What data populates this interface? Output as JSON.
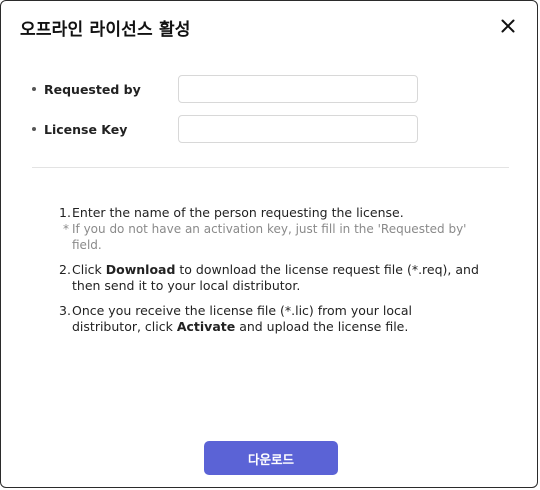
{
  "dialog": {
    "title": "오프라인 라이선스 활성",
    "close_icon": "close-icon"
  },
  "form": {
    "requested_by": {
      "label": "Requested by",
      "value": "",
      "placeholder": ""
    },
    "license_key": {
      "label": "License Key",
      "value": "",
      "placeholder": ""
    }
  },
  "instructions": {
    "step1": {
      "num": "1.",
      "text": "Enter the name of the person requesting the license.",
      "note_star": "*",
      "note": "If you do not have an activation key, just fill in the 'Requested by' field."
    },
    "step2": {
      "num": "2.",
      "pre": "Click ",
      "bold": "Download",
      "post": " to download the license request file (*.req), and then send it to your local distributor."
    },
    "step3": {
      "num": "3.",
      "pre": "Once you receive the license file (*.lic) from your local distributor, click ",
      "bold": "Activate",
      "post": " and upload the license file."
    }
  },
  "footer": {
    "download_label": "다운로드"
  },
  "colors": {
    "primary_button": "#5b63d6",
    "border": "#2b2b2b"
  }
}
